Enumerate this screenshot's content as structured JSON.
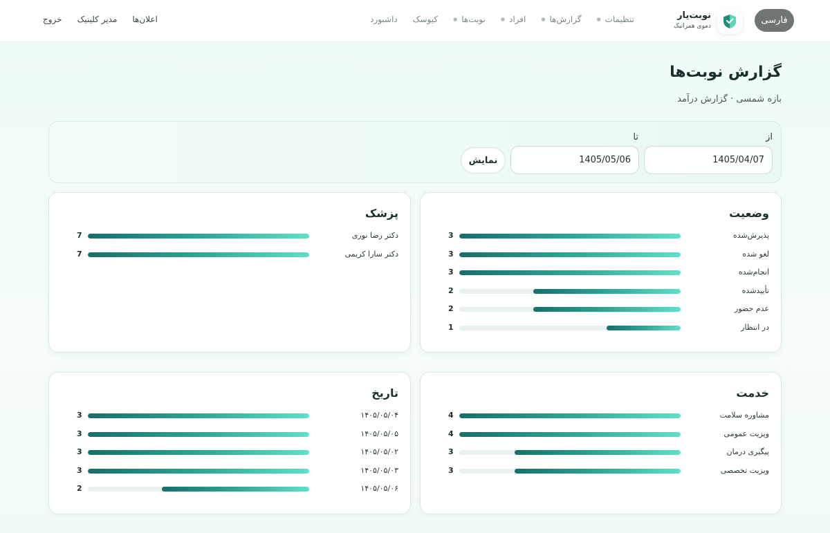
{
  "topbar": {
    "lang_label": "فارسی",
    "brand_title": "نوبت‌یار",
    "brand_sub": "دموی همراتیک",
    "nav": [
      {
        "label": "داشبورد",
        "dot": false
      },
      {
        "label": "کیوسک",
        "dot": false
      },
      {
        "label": "نوبت‌ها",
        "dot": true
      },
      {
        "label": "افراد",
        "dot": true
      },
      {
        "label": "گزارش‌ها",
        "dot": true
      },
      {
        "label": "تنظیمات",
        "dot": true
      }
    ],
    "left_links": [
      "خروج",
      "مدیر کلینیک",
      "اعلان‌ها"
    ]
  },
  "header": {
    "title": "گزارش نوبت‌ها",
    "subtitle": "بازه شمسی · گزارش درآمد"
  },
  "filter": {
    "from_label": "از",
    "to_label": "تا",
    "from_value": "1405/04/07",
    "to_value": "1405/05/06",
    "show_label": "نمایش"
  },
  "cards": {
    "status": {
      "title": "وضعیت",
      "max": 3,
      "rows": [
        {
          "label": "پذیرش‌شده",
          "value": 3
        },
        {
          "label": "لغو شده",
          "value": 3
        },
        {
          "label": "انجام‌شده",
          "value": 3
        },
        {
          "label": "تأییدشده",
          "value": 2
        },
        {
          "label": "عدم حضور",
          "value": 2
        },
        {
          "label": "در انتظار",
          "value": 1
        }
      ]
    },
    "doctor": {
      "title": "پزشک",
      "max": 7,
      "rows": [
        {
          "label": "دکتر رضا نوری",
          "value": 7
        },
        {
          "label": "دکتر سارا کریمی",
          "value": 7
        }
      ]
    },
    "service": {
      "title": "خدمت",
      "max": 4,
      "rows": [
        {
          "label": "مشاوره سلامت",
          "value": 4
        },
        {
          "label": "ویزیت عمومی",
          "value": 4
        },
        {
          "label": "پیگیری درمان",
          "value": 3
        },
        {
          "label": "ویزیت تخصصی",
          "value": 3
        }
      ]
    },
    "date": {
      "title": "تاریخ",
      "max": 3,
      "rows": [
        {
          "label": "۱۴۰۵/۰۵/۰۴",
          "value": 3
        },
        {
          "label": "۱۴۰۵/۰۵/۰۵",
          "value": 3
        },
        {
          "label": "۱۴۰۵/۰۵/۰۲",
          "value": 3
        },
        {
          "label": "۱۴۰۵/۰۵/۰۳",
          "value": 3
        },
        {
          "label": "۱۴۰۵/۰۵/۰۶",
          "value": 2
        }
      ]
    }
  }
}
